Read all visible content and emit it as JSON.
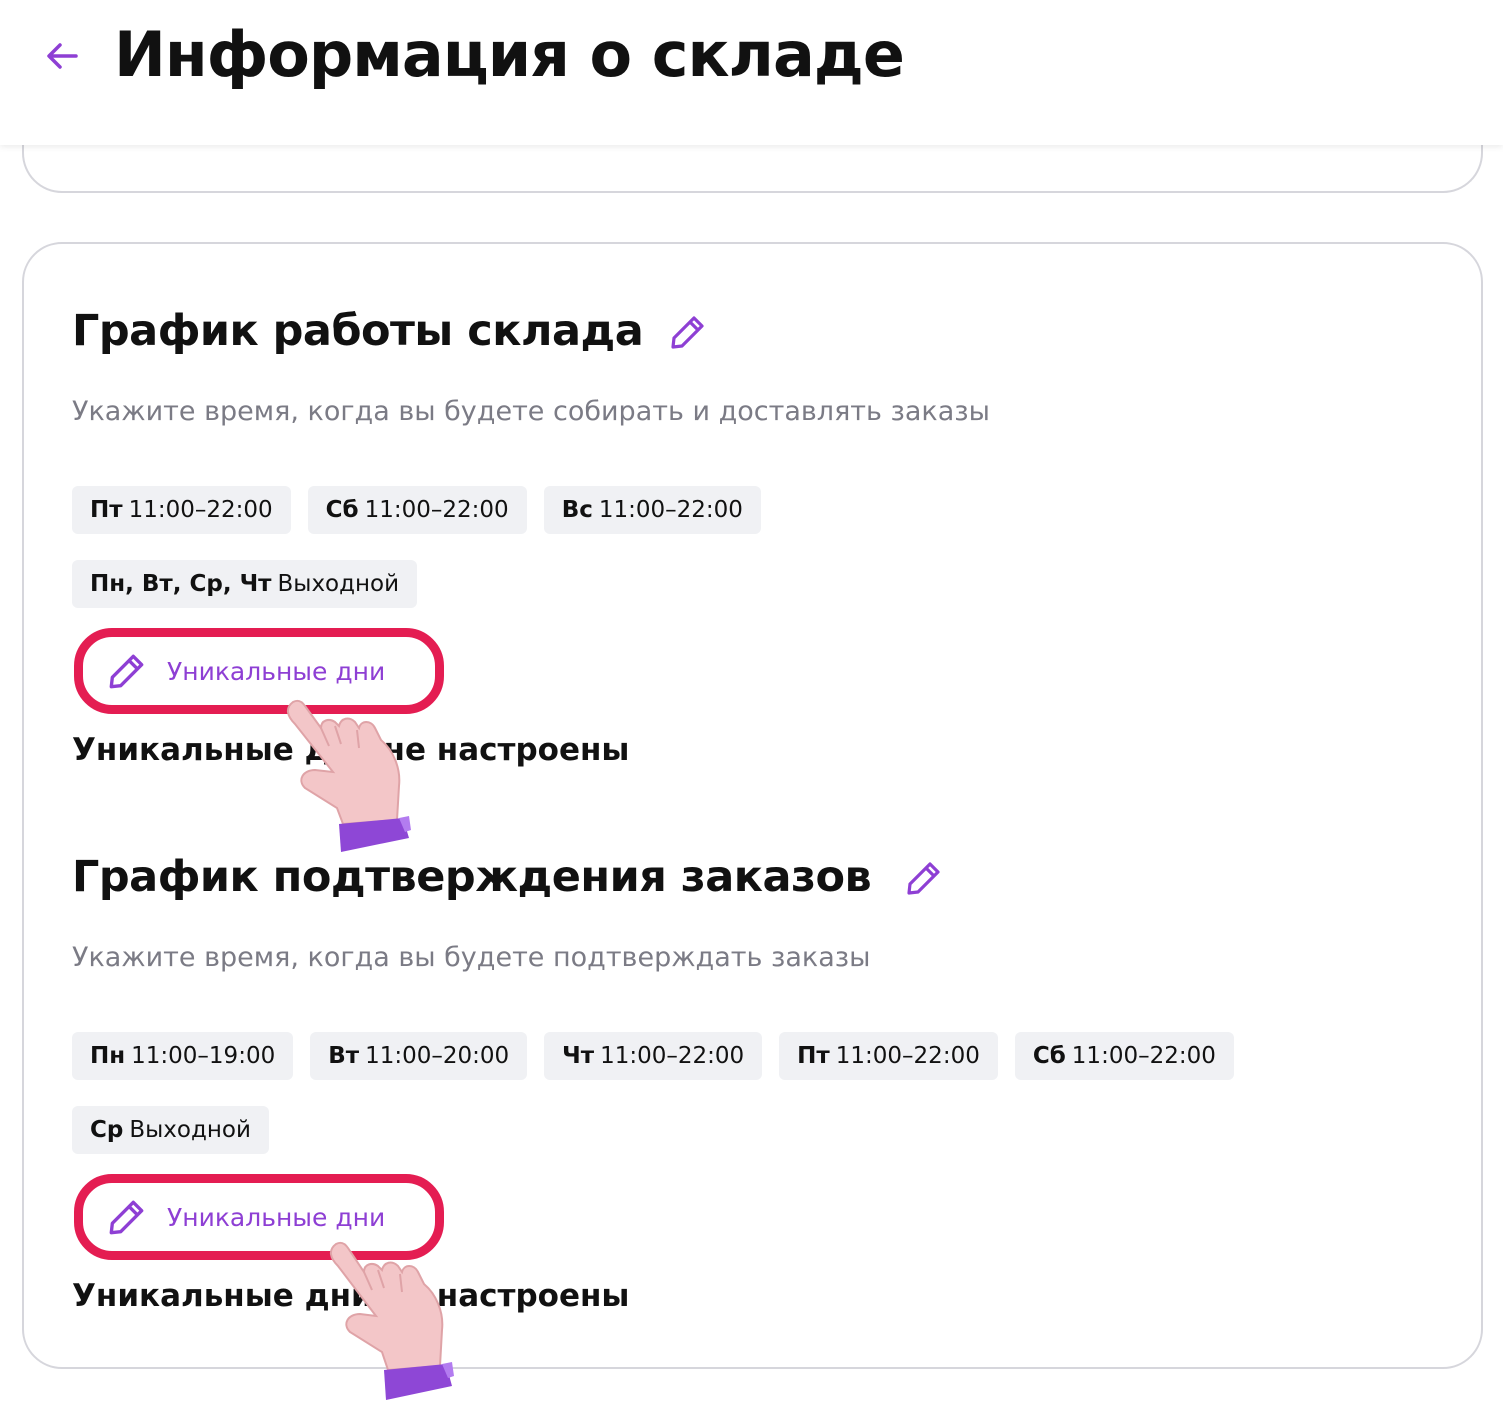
{
  "header": {
    "title": "Информация о складе",
    "back_icon": "arrow-left-icon"
  },
  "colors": {
    "accent": "#8e3fd4",
    "highlight": "#e41d52",
    "chip_bg": "#f0f1f4",
    "border": "#d6d6dc",
    "muted_text": "#7b7b85"
  },
  "work_schedule": {
    "title": "График работы склада",
    "edit_icon": "pencil-icon",
    "subtitle": "Укажите время, когда вы будете собирать и доставлять заказы",
    "chips_row1": [
      {
        "day": "Пт",
        "time": "11:00–22:00"
      },
      {
        "day": "Сб",
        "time": "11:00–22:00"
      },
      {
        "day": "Вс",
        "time": "11:00–22:00"
      }
    ],
    "chips_row2": [
      {
        "day": "Пн, Вт, Ср, Чт",
        "time": "Выходной"
      }
    ],
    "unique_button_label": "Уникальные дни",
    "unique_status": "Уникальные дни не настроены"
  },
  "confirm_schedule": {
    "title": "График подтверждения заказов",
    "edit_icon": "pencil-icon",
    "subtitle": "Укажите время, когда вы будете подтверждать заказы",
    "chips_row1": [
      {
        "day": "Пн",
        "time": "11:00–19:00"
      },
      {
        "day": "Вт",
        "time": "11:00–20:00"
      },
      {
        "day": "Чт",
        "time": "11:00–22:00"
      },
      {
        "day": "Пт",
        "time": "11:00–22:00"
      },
      {
        "day": "Сб",
        "time": "11:00–22:00"
      }
    ],
    "chips_row2": [
      {
        "day": "Ср",
        "time": "Выходной"
      }
    ],
    "unique_button_label": "Уникальные дни",
    "unique_status": "Уникальные дни не настроены"
  }
}
